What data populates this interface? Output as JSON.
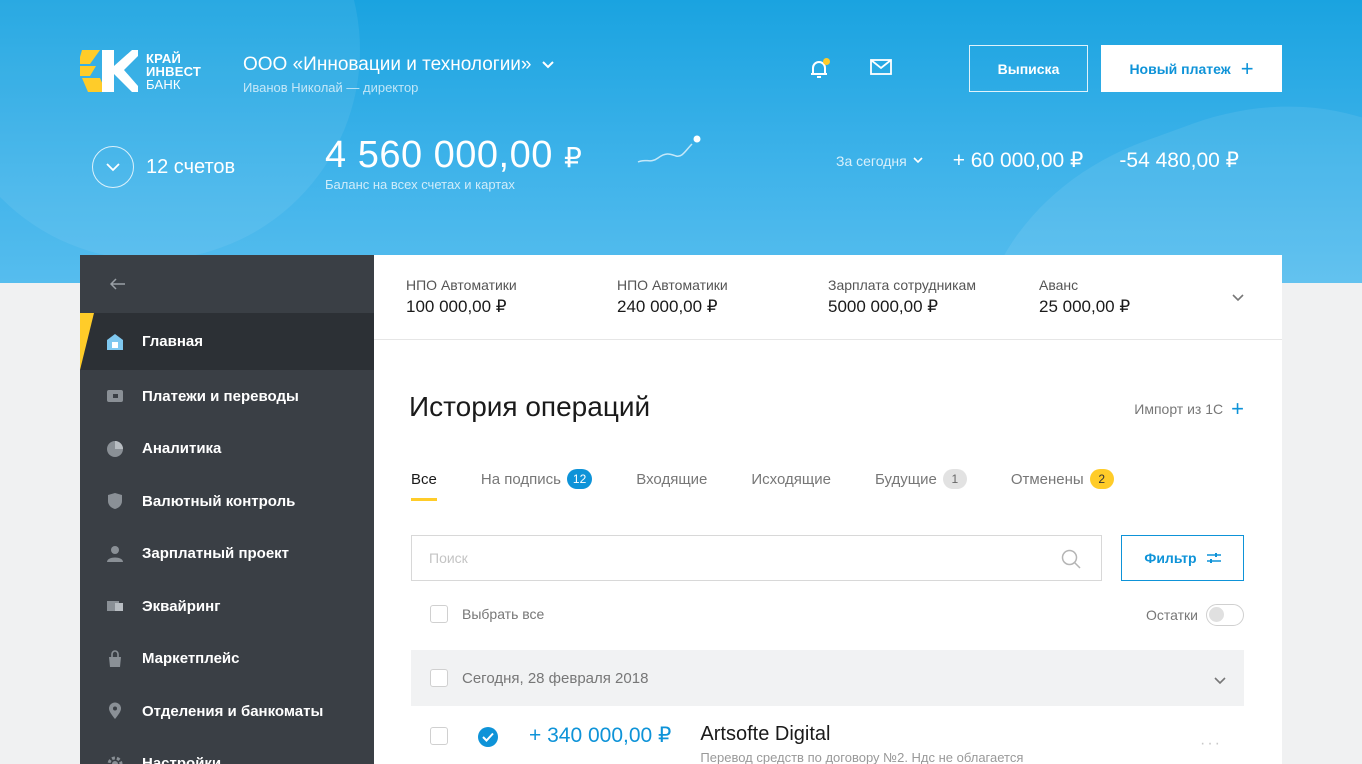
{
  "header": {
    "logo": {
      "line1": "КРАЙ",
      "line2": "ИНВЕСТ",
      "line3": "БАНК"
    },
    "company_name": "ООО «Инновации и технологии»",
    "company_sub": "Иванов Николай — директор",
    "statement_button": "Выписка",
    "new_payment_button": "Новый платеж",
    "accounts_label": "12 счетов",
    "balance_value": "4 560 000,00",
    "currency": "₽",
    "balance_sub": "Баланс на всех счетах и картах",
    "period_label": "За сегодня",
    "today_income": "+ 60 000,00 ₽",
    "today_expense": "-54 480,00 ₽"
  },
  "sidebar": {
    "items": [
      {
        "label": "Главная",
        "icon": "home-icon"
      },
      {
        "label": "Платежи и переводы",
        "icon": "wallet-icon"
      },
      {
        "label": "Аналитика",
        "icon": "pie-chart-icon"
      },
      {
        "label": "Валютный контроль",
        "icon": "shield-icon"
      },
      {
        "label": "Зарплатный проект",
        "icon": "user-icon"
      },
      {
        "label": "Эквайринг",
        "icon": "card-icon"
      },
      {
        "label": "Маркетплейс",
        "icon": "bag-icon"
      },
      {
        "label": "Отделения и банкоматы",
        "icon": "location-icon"
      },
      {
        "label": "Настройки",
        "icon": "gear-icon"
      }
    ]
  },
  "quick_payments": [
    {
      "name": "НПО Автоматики",
      "value": "100 000,00 ₽"
    },
    {
      "name": "НПО Автоматики",
      "value": "240 000,00 ₽"
    },
    {
      "name": "Зарплата сотрудникам",
      "value": "5000 000,00 ₽"
    },
    {
      "name": "Аванс",
      "value": "25 000,00 ₽"
    }
  ],
  "history": {
    "title": "История операций",
    "import_label": "Импорт из 1С",
    "tabs": [
      {
        "label": "Все",
        "badge": ""
      },
      {
        "label": "На подпись",
        "badge": "12"
      },
      {
        "label": "Входящие",
        "badge": ""
      },
      {
        "label": "Исходящие",
        "badge": ""
      },
      {
        "label": "Будущие",
        "badge": "1"
      },
      {
        "label": "Отменены",
        "badge": "2"
      }
    ],
    "search_placeholder": "Поиск",
    "filter_label": "Фильтр",
    "select_all": "Выбрать все",
    "remains_label": "Остатки",
    "group_label": "Сегодня, 28 февраля 2018",
    "operation": {
      "amount": "+ 340 000,00 ₽",
      "name": "Artsofte Digital",
      "desc": "Перевод средств по договору №2. Ндс не облагается"
    }
  },
  "colors": {
    "accent": "#0e93d8",
    "brand_yellow": "#ffcc29",
    "sidebar": "#3a3f45"
  }
}
